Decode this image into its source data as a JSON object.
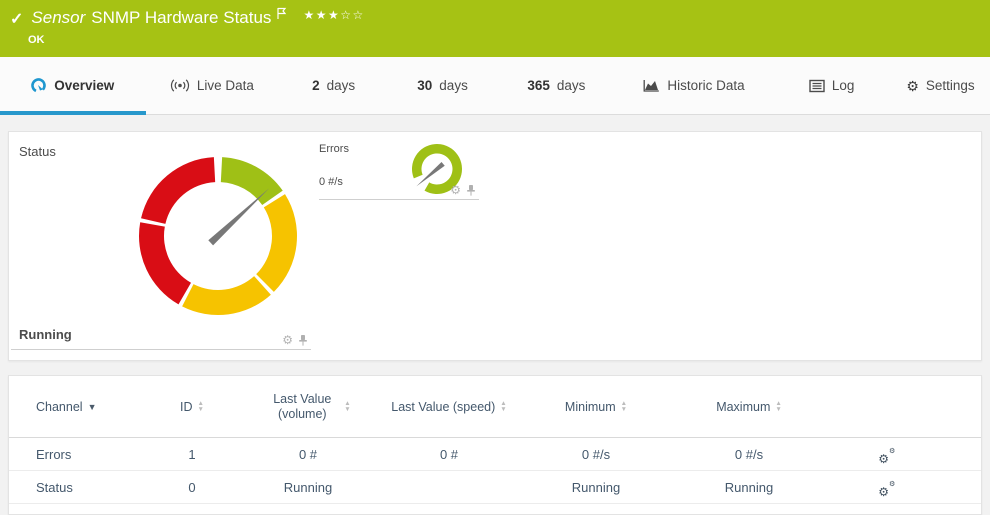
{
  "header": {
    "kind": "Sensor",
    "title": "SNMP Hardware Status",
    "status": "OK",
    "stars_filled": "★★★",
    "stars_empty": "☆☆"
  },
  "tabs": {
    "overview": "Overview",
    "live_data": "Live Data",
    "d2_num": "2",
    "d2_label": "days",
    "d30_num": "30",
    "d30_label": "days",
    "d365_num": "365",
    "d365_label": "days",
    "historic": "Historic Data",
    "log": "Log",
    "settings": "Settings"
  },
  "gauges": {
    "status": {
      "label": "Status",
      "value": "Running",
      "needle_angle": 47,
      "segments": [
        {
          "from": 3,
          "to": 55,
          "color": "#9fc016"
        },
        {
          "from": 58,
          "to": 135,
          "color": "#f6c300"
        },
        {
          "from": 138,
          "to": 207,
          "color": "#f6c300"
        },
        {
          "from": 210,
          "to": 280,
          "color": "#d90d15"
        },
        {
          "from": 283,
          "to": 357,
          "color": "#d90d15"
        }
      ]
    },
    "errors": {
      "label": "Errors",
      "value": "0 #/s",
      "needle_angle": 230,
      "segments": [
        {
          "from": -112,
          "to": 210,
          "color": "#9fc016"
        }
      ]
    }
  },
  "table": {
    "columns": {
      "channel": "Channel",
      "id": "ID",
      "last_volume": "Last Value (volume)",
      "last_speed": "Last Value (speed)",
      "minimum": "Minimum",
      "maximum": "Maximum"
    },
    "rows": [
      {
        "channel": "Errors",
        "id": "1",
        "last_volume": "0 #",
        "last_speed": "0 #",
        "minimum": "0 #/s",
        "maximum": "0 #/s"
      },
      {
        "channel": "Status",
        "id": "0",
        "last_volume": "Running",
        "last_speed": "",
        "minimum": "Running",
        "maximum": "Running"
      }
    ]
  },
  "colors": {
    "header_bg": "#a6c214",
    "ok_green": "#9fc016",
    "warning_yellow": "#f6c300",
    "error_red": "#d90d15",
    "accent_blue": "#2798cc",
    "needle_gray": "#787878"
  }
}
